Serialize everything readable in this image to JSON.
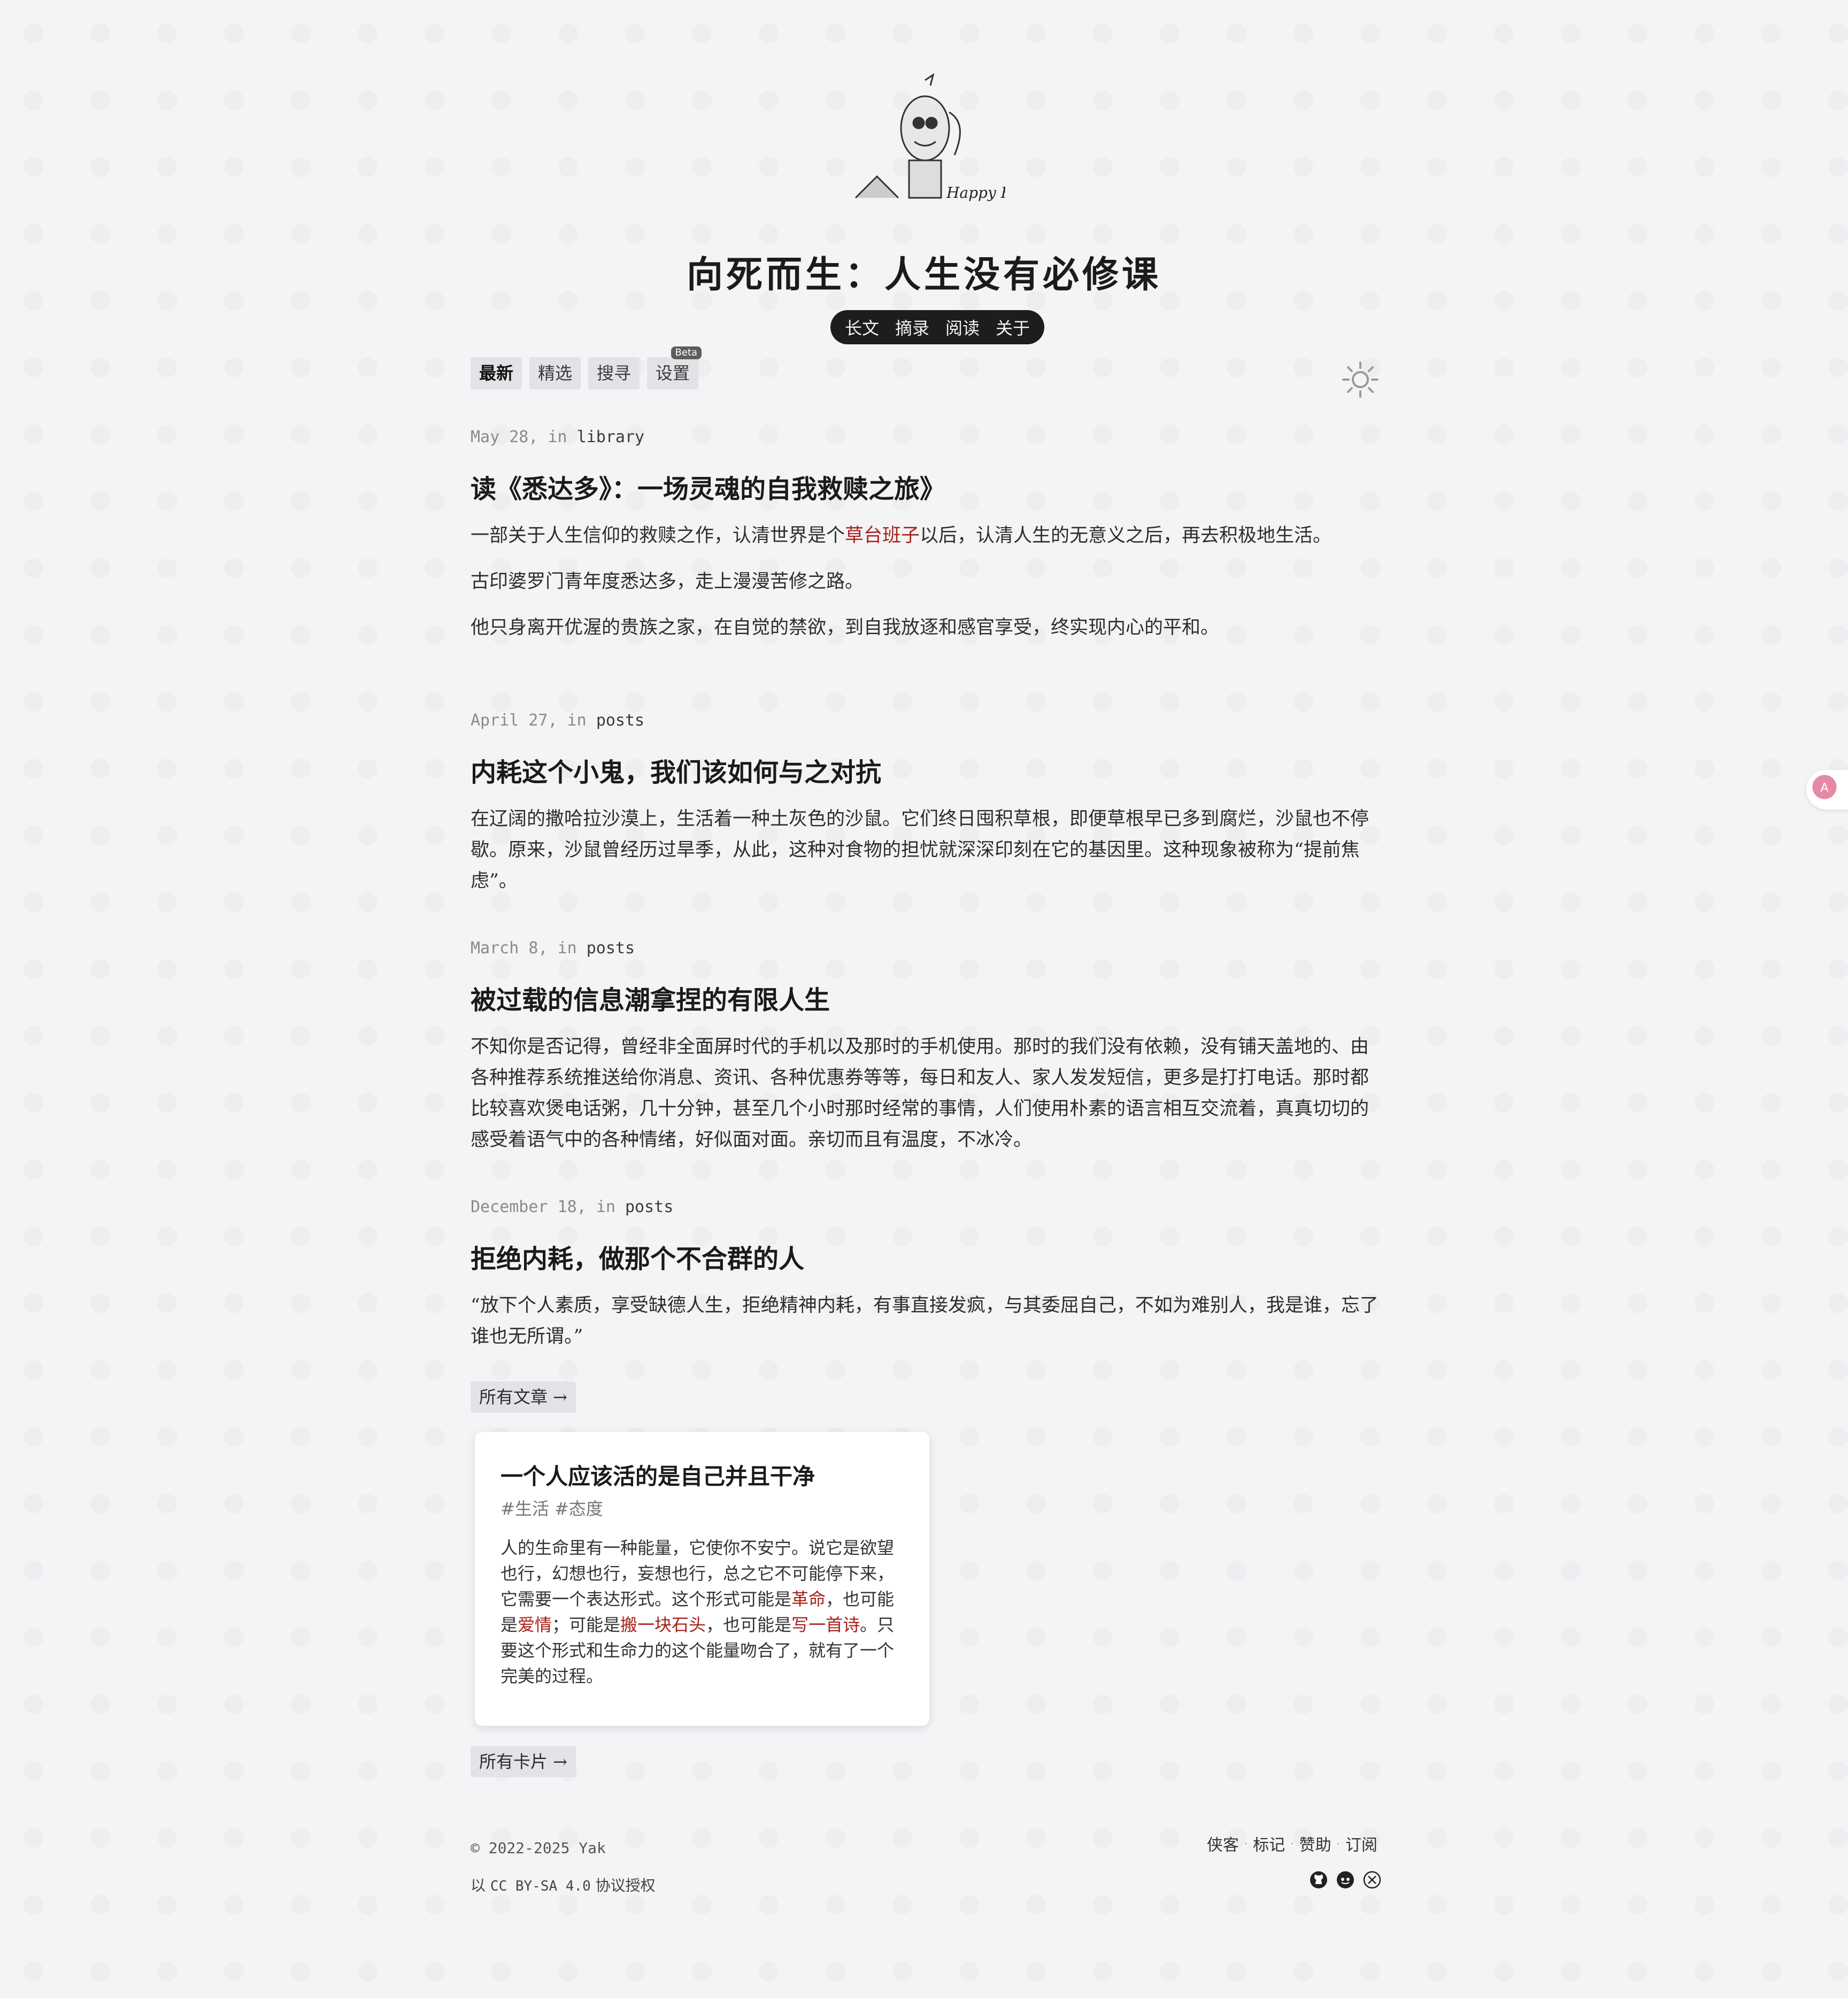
{
  "site": {
    "title": "向死而生：人生没有必修课",
    "logo_text": "Happy Halloween"
  },
  "top_nav": [
    "长文",
    "摘录",
    "阅读",
    "关于"
  ],
  "tabs": [
    {
      "label": "最新",
      "active": true
    },
    {
      "label": "精选"
    },
    {
      "label": "搜寻"
    },
    {
      "label": "设置",
      "badge": "Beta"
    }
  ],
  "posts": [
    {
      "date": "May 28,",
      "in": "in",
      "category": "library",
      "title": "读《悉达多》：一场灵魂的自我救赎之旅》",
      "p1_a": "一部关于人生信仰的救赎之作，认清世界是个",
      "p1_link": "草台班子",
      "p1_b": "以后，认清人生的无意义之后，再去积极地生活。",
      "p2": "古印婆罗门青年度悉达多，走上漫漫苦修之路。",
      "p3": "他只身离开优渥的贵族之家，在自觉的禁欲，到自我放逐和感官享受，终实现内心的平和。"
    },
    {
      "date": "April 27,",
      "in": "in",
      "category": "posts",
      "title": "内耗这个小鬼，我们该如何与之对抗",
      "p1": "在辽阔的撒哈拉沙漠上，生活着一种土灰色的沙鼠。它们终日囤积草根，即便草根早已多到腐烂，沙鼠也不停歇。原来，沙鼠曾经历过旱季，从此，这种对食物的担忧就深深印刻在它的基因里。这种现象被称为“提前焦虑”。"
    },
    {
      "date": "March 8,",
      "in": "in",
      "category": "posts",
      "title": "被过载的信息潮拿捏的有限人生",
      "p1": "不知你是否记得，曾经非全面屏时代的手机以及那时的手机使用。那时的我们没有依赖，没有铺天盖地的、由各种推荐系统推送给你消息、资讯、各种优惠券等等，每日和友人、家人发发短信，更多是打打电话。那时都比较喜欢煲电话粥，几十分钟，甚至几个小时那时经常的事情，人们使用朴素的语言相互交流着，真真切切的感受着语气中的各种情绪，好似面对面。亲切而且有温度，不冰冷。"
    },
    {
      "date": "December 18,",
      "in": "in",
      "category": "posts",
      "title": "拒绝内耗，做那个不合群的人",
      "p1": "“放下个人素质，享受缺德人生，拒绝精神内耗，有事直接发疯，与其委屈自己，不如为难别人，我是谁，忘了谁也无所谓。”"
    }
  ],
  "all_posts_button": "所有文章 →",
  "card": {
    "title": "一个人应该活的是自己并且干净",
    "tags": "#生活 #态度",
    "body_1": "人的生命里有一种能量，它使你不安宁。说它是欲望也行，幻想也行，妄想也行，总之它不可能停下来，它需要一个表达形式。这个形式可能是",
    "link_1": "革命",
    "body_2": "，也可能是",
    "link_2": "爱情",
    "body_3": "；可能是",
    "link_3": "搬一块石头",
    "body_4": "，也可能是",
    "link_4": "写一首诗",
    "body_5": "。只要这个形式和生命力的这个能量吻合了，就有了一个完美的过程。"
  },
  "all_cards_button": "所有卡片 →",
  "footer": {
    "copyright": "© 2022-2025 Yak",
    "license_prefix": "以",
    "license_name": "CC BY-SA 4.0",
    "license_suffix": "协议授权",
    "links": [
      "侠客",
      "标记",
      "赞助",
      "订阅"
    ],
    "icons": [
      "github-icon",
      "discord-icon",
      "x-icon"
    ]
  },
  "colors": {
    "accent_red": "#a8201a",
    "nav_bg": "#1d1d1f",
    "page_bg": "#f4f3f6"
  }
}
